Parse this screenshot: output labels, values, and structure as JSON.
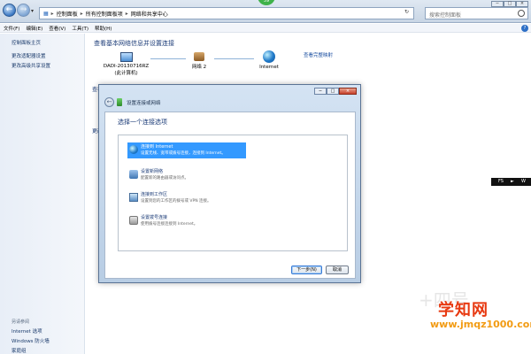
{
  "window": {
    "badge": "59",
    "breadcrumb": [
      "控制面板",
      "所有控制面板项",
      "网络和共享中心"
    ],
    "search_placeholder": "搜索控制面板",
    "minimize": "−",
    "maximize": "□",
    "close": "×"
  },
  "menubar": {
    "items": [
      "文件(F)",
      "编辑(E)",
      "查看(V)",
      "工具(T)",
      "帮助(H)"
    ]
  },
  "sidebar": {
    "items": [
      "控制面板主页",
      "更改适配器设置",
      "更改高级共享设置"
    ],
    "see_also": "另请参阅",
    "bottom_items": [
      "Internet 选项",
      "Windows 防火墙",
      "家庭组"
    ]
  },
  "main": {
    "title": "查看基本网络信息并设置连接",
    "full_map": "查看完整映射",
    "nodes": [
      {
        "label": "DADI-20130716RZ",
        "sub": "(此计算机)"
      },
      {
        "label": "网络 2",
        "sub": ""
      },
      {
        "label": "Internet",
        "sub": ""
      }
    ],
    "cut_label_1": "查看",
    "cut_label_2": "更改"
  },
  "dialog": {
    "title": "设置连接或网络",
    "heading": "选择一个连接选项",
    "options": [
      {
        "title": "连接到 Internet",
        "desc": "设置无线、宽带或拨号连接，连接到 Internet。",
        "icon": "globe-icon",
        "selected": true
      },
      {
        "title": "设置新网络",
        "desc": "配置新的路由器或访问点。",
        "icon": "router-icon",
        "selected": false
      },
      {
        "title": "连接到工作区",
        "desc": "设置到您的工作区的拨号或 VPN 连接。",
        "icon": "workplace-icon",
        "selected": false
      },
      {
        "title": "设置拨号连接",
        "desc": "使用拨号连接连接到 Internet。",
        "icon": "phone-icon",
        "selected": false
      }
    ],
    "next_button": "下一步(N)",
    "cancel_button": "取消",
    "minimize": "−",
    "maximize": "□",
    "close": "×"
  },
  "overlay": {
    "media_left": "FS",
    "media_right": "W"
  },
  "watermark": {
    "brand": "学知网",
    "url": "www.jmqz1000.com",
    "ghost": "+四号"
  },
  "colors": {
    "accent": "#1c3c78",
    "selection": "#3399ff",
    "watermark_red": "#e83a12",
    "watermark_orange": "#f29b12"
  }
}
